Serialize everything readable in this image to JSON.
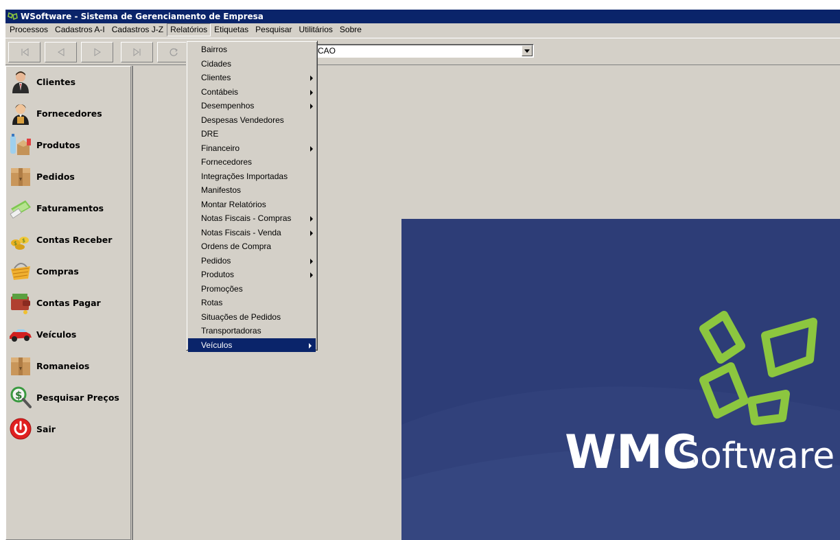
{
  "window": {
    "title": "WSoftware - Sistema de Gerenciamento de Empresa"
  },
  "menubar": {
    "items": [
      "Processos",
      "Cadastros A-I",
      "Cadastros J-Z",
      "Relatórios",
      "Etiquetas",
      "Pesquisar",
      "Utilitários",
      "Sobre"
    ],
    "open_item": "Relatórios"
  },
  "toolbar": {
    "buttons": [
      "first-record-icon",
      "previous-record-icon",
      "next-record-icon",
      "last-record-icon",
      "refresh-icon"
    ],
    "combo_value": "ACAO"
  },
  "sidebar": {
    "items": [
      {
        "label": "Clientes",
        "icon": "client-person-icon"
      },
      {
        "label": "Fornecedores",
        "icon": "supplier-person-icon"
      },
      {
        "label": "Produtos",
        "icon": "products-icon"
      },
      {
        "label": "Pedidos",
        "icon": "box-icon"
      },
      {
        "label": "Faturamentos",
        "icon": "invoice-icon"
      },
      {
        "label": "Contas Receber",
        "icon": "coins-icon"
      },
      {
        "label": "Compras",
        "icon": "shopping-basket-icon"
      },
      {
        "label": "Contas Pagar",
        "icon": "wallet-icon"
      },
      {
        "label": "Veículos",
        "icon": "car-icon"
      },
      {
        "label": "Romaneios",
        "icon": "box-icon"
      },
      {
        "label": "Pesquisar Preços",
        "icon": "price-search-icon"
      },
      {
        "label": "Sair",
        "icon": "power-icon"
      }
    ]
  },
  "relatorios_menu": {
    "items": [
      {
        "label": "Bairros",
        "submenu": false
      },
      {
        "label": "Cidades",
        "submenu": false
      },
      {
        "label": "Clientes",
        "submenu": true
      },
      {
        "label": "Contábeis",
        "submenu": true
      },
      {
        "label": "Desempenhos",
        "submenu": true
      },
      {
        "label": "Despesas Vendedores",
        "submenu": false
      },
      {
        "label": "DRE",
        "submenu": false
      },
      {
        "label": "Financeiro",
        "submenu": true
      },
      {
        "label": "Fornecedores",
        "submenu": false
      },
      {
        "label": "Integrações Importadas",
        "submenu": false
      },
      {
        "label": "Manifestos",
        "submenu": false
      },
      {
        "label": "Montar Relatórios",
        "submenu": false
      },
      {
        "label": "Notas Fiscais - Compras",
        "submenu": true
      },
      {
        "label": "Notas Fiscais - Venda",
        "submenu": true
      },
      {
        "label": "Ordens de Compra",
        "submenu": false
      },
      {
        "label": "Pedidos",
        "submenu": true
      },
      {
        "label": "Produtos",
        "submenu": true
      },
      {
        "label": "Promoções",
        "submenu": false
      },
      {
        "label": "Rotas",
        "submenu": false
      },
      {
        "label": "Situações de Pedidos",
        "submenu": false
      },
      {
        "label": "Transportadoras",
        "submenu": false
      },
      {
        "label": "Veículos",
        "submenu": true,
        "selected": true
      }
    ]
  },
  "splash": {
    "logo_bold": "WMC",
    "logo_light": "Software"
  },
  "colors": {
    "titlebar": "#0a246a",
    "face": "#d4d0c8",
    "splash_bg": "#2d3d77",
    "logo_green": "#8cc63f"
  }
}
